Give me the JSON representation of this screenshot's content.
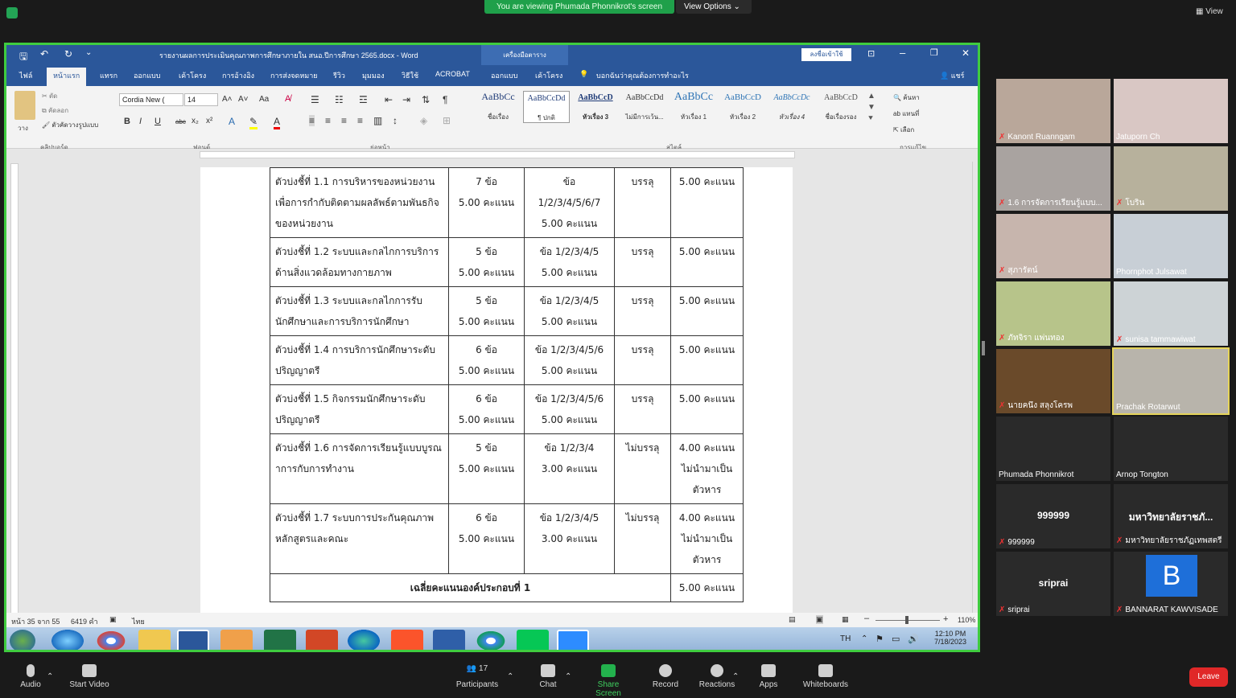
{
  "zoom_top": {
    "viewing_banner": "You are viewing Phumada Phonnikrot's screen",
    "view_options": "View Options",
    "view_button": "View"
  },
  "word": {
    "doc_title": "รายงานผลการประเมินคุณภาพการศึกษาภายใน สนอ.ปีการศึกษา 2565.docx - Word",
    "context_tab": "เครื่องมือตาราง",
    "signin": "ลงชื่อเข้าใช้",
    "tabs": [
      "ไฟล์",
      "หน้าแรก",
      "แทรก",
      "ออกแบบ",
      "เค้าโครง",
      "การอ้างอิง",
      "การส่งจดหมาย",
      "รีวิว",
      "มุมมอง",
      "วิธีใช้",
      "ACROBAT",
      "ออกแบบ",
      "เค้าโครง"
    ],
    "tell_me": "บอกฉันว่าคุณต้องการทำอะไร",
    "share": "แชร์",
    "font_name": "Cordia New (",
    "font_size": "14",
    "clipboard": {
      "cut": "ตัด",
      "copy": "คัดลอก",
      "format_painter": "ตัวคัดวางรูปแบบ",
      "paste": "วาง"
    },
    "groups": {
      "clipboard": "คลิปบอร์ด",
      "font": "ฟอนต์",
      "paragraph": "ย่อหน้า",
      "styles": "สไตล์",
      "editing": "การแก้ไข"
    },
    "styles": [
      {
        "sample": "AaBbCc",
        "label": "ชื่อเรื่อง"
      },
      {
        "sample": "AaBbCcDd",
        "label": "¶ ปกติ"
      },
      {
        "sample": "AaBbCcD",
        "label": "หัวเรื่อง 3"
      },
      {
        "sample": "AaBbCcDd",
        "label": "ไม่มีการเว้น..."
      },
      {
        "sample": "AaBbCc",
        "label": "หัวเรื่อง 1"
      },
      {
        "sample": "AaBbCcD",
        "label": "หัวเรื่อง 2"
      },
      {
        "sample": "AaBbCcDc",
        "label": "หัวเรื่อง 4"
      },
      {
        "sample": "AaBbCcD",
        "label": "ชื่อเรื่องรอง"
      }
    ],
    "editing": {
      "find": "ค้นหา",
      "replace": "แทนที่",
      "select": "เลือก"
    },
    "status": {
      "page": "หน้า 35 จาก 55",
      "words": "6419 คำ",
      "lang": "ไทย",
      "zoom": "110%"
    },
    "table": {
      "rows": [
        {
          "indicator": "ตัวบ่งชี้ที่ 1.1 การบริหารของหน่วยงานเพื่อการกำกับติดตามผลลัพธ์ตามพันธกิจของหน่วยงาน",
          "target": "7 ข้อ\n5.00 คะแนน",
          "result": "ข้อ\n1/2/3/4/5/6/7\n5.00 คะแนน",
          "achieved": "บรรลุ",
          "score": "5.00 คะแนน"
        },
        {
          "indicator": "ตัวบ่งชี้ที่ 1.2 ระบบและกลไกการบริการด้านสิ่งแวดล้อมทางกายภาพ",
          "target": "5 ข้อ\n5.00 คะแนน",
          "result": "ข้อ 1/2/3/4/5\n5.00 คะแนน",
          "achieved": "บรรลุ",
          "score": "5.00 คะแนน"
        },
        {
          "indicator": "ตัวบ่งชี้ที่ 1.3 ระบบและกลไกการรับนักศึกษาและการบริการนักศึกษา",
          "target": "5 ข้อ\n5.00 คะแนน",
          "result": "ข้อ 1/2/3/4/5\n5.00 คะแนน",
          "achieved": "บรรลุ",
          "score": "5.00 คะแนน"
        },
        {
          "indicator": "ตัวบ่งชี้ที่ 1.4 การบริการนักศึกษาระดับปริญญาตรี",
          "target": "6 ข้อ\n5.00 คะแนน",
          "result": "ข้อ 1/2/3/4/5/6\n5.00 คะแนน",
          "achieved": "บรรลุ",
          "score": "5.00 คะแนน"
        },
        {
          "indicator": "ตัวบ่งชี้ที่ 1.5 กิจกรรมนักศึกษาระดับปริญญาตรี",
          "target": "6 ข้อ\n5.00 คะแนน",
          "result": "ข้อ 1/2/3/4/5/6\n5.00 คะแนน",
          "achieved": "บรรลุ",
          "score": "5.00 คะแนน"
        },
        {
          "indicator": "ตัวบ่งชี้ที่ 1.6 การจัดการเรียนรู้แบบบูรณาการกับการทำงาน",
          "target": "5 ข้อ\n5.00 คะแนน",
          "result": "ข้อ 1/2/3/4\n3.00 คะแนน",
          "achieved": "ไม่บรรลุ",
          "score": "4.00 คะแนน\nไม่นำมาเป็นตัวหาร"
        },
        {
          "indicator": "ตัวบ่งชี้ที่ 1.7 ระบบการประกันคุณภาพหลักสูตรและคณะ",
          "target": "6 ข้อ\n5.00 คะแนน",
          "result": "ข้อ 1/2/3/4/5\n3.00 คะแนน",
          "achieved": "ไม่บรรลุ",
          "score": "4.00 คะแนน\nไม่นำมาเป็นตัวหาร"
        }
      ],
      "average_label": "เฉลี่ยคะแนนองค์ประกอบที่ 1",
      "average_score": "5.00 คะแนน"
    }
  },
  "taskbar": {
    "lang": "TH",
    "time": "12:10 PM",
    "date": "7/18/2023"
  },
  "participants": [
    {
      "name": "Kanont Ruanngam",
      "muted": true,
      "bg": "#b9a79a"
    },
    {
      "name": "Jatuporn Ch",
      "muted": false,
      "bg": "#d9c7c4"
    },
    {
      "name": "1.6 การจัดการเรียนรู้แบบ...",
      "muted": true,
      "bg": "#a9a3a0"
    },
    {
      "name": "โบริน",
      "muted": true,
      "bg": "#b7b19c"
    },
    {
      "name": "สุภารัตน์",
      "muted": true,
      "bg": "#c7b5ad"
    },
    {
      "name": "Phornphot Julsawat",
      "muted": false,
      "bg": "#c8cfd6"
    },
    {
      "name": "ภัทจิรา แพ่นทอง",
      "muted": true,
      "bg": "#b7c48a"
    },
    {
      "name": "sunisa tammawiwat",
      "muted": true,
      "bg": "#cdd3d6"
    },
    {
      "name": "นายคนึง สลุงโครพ",
      "muted": true,
      "bg": "#6a4a2a"
    },
    {
      "name": "Prachak Rotarwut",
      "muted": false,
      "bg": "#b8b4ab"
    },
    {
      "name": "Phumada Phonnikrot",
      "muted": false,
      "bg": "#2a2a2a"
    },
    {
      "name": "Arnop Tongton",
      "muted": false,
      "bg": "#2a2a2a"
    },
    {
      "name": "999999",
      "muted": true,
      "bg": "#2a2a2a",
      "big": "999999"
    },
    {
      "name": "มหาวิทยาลัยราชภัฏเทพสตรี",
      "muted": true,
      "bg": "#2a2a2a",
      "big": "มหาวิทยาลัยราชภั..."
    },
    {
      "name": "sriprai",
      "muted": true,
      "bg": "#2a2a2a",
      "big": "sriprai"
    },
    {
      "name": "BANNARAT KAWVISADE",
      "muted": true,
      "bg": "#2a2a2a",
      "avatar": "B"
    }
  ],
  "bottom": {
    "audio": "Audio",
    "video": "Start Video",
    "participants": "Participants",
    "participants_count": "17",
    "chat": "Chat",
    "share": "Share Screen",
    "record": "Record",
    "reactions": "Reactions",
    "apps": "Apps",
    "whiteboards": "Whiteboards",
    "leave": "Leave"
  }
}
